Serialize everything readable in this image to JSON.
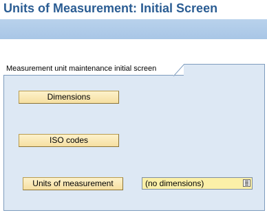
{
  "window": {
    "title": "Units of Measurement: Initial Screen"
  },
  "group": {
    "title": "Measurement unit maintenance initial screen"
  },
  "buttons": {
    "dimensions": "Dimensions",
    "iso_codes": "ISO codes",
    "units_of_measurement": "Units of measurement"
  },
  "dimension_select": {
    "value": "(no dimensions)",
    "icon": "dropdown-list-icon"
  },
  "colors": {
    "title": "#2b5d93",
    "toolbar": "#b9d2ec",
    "group_background": "#dde8f4",
    "button": "#f6dfa1",
    "select_background": "#fbf0a8"
  }
}
